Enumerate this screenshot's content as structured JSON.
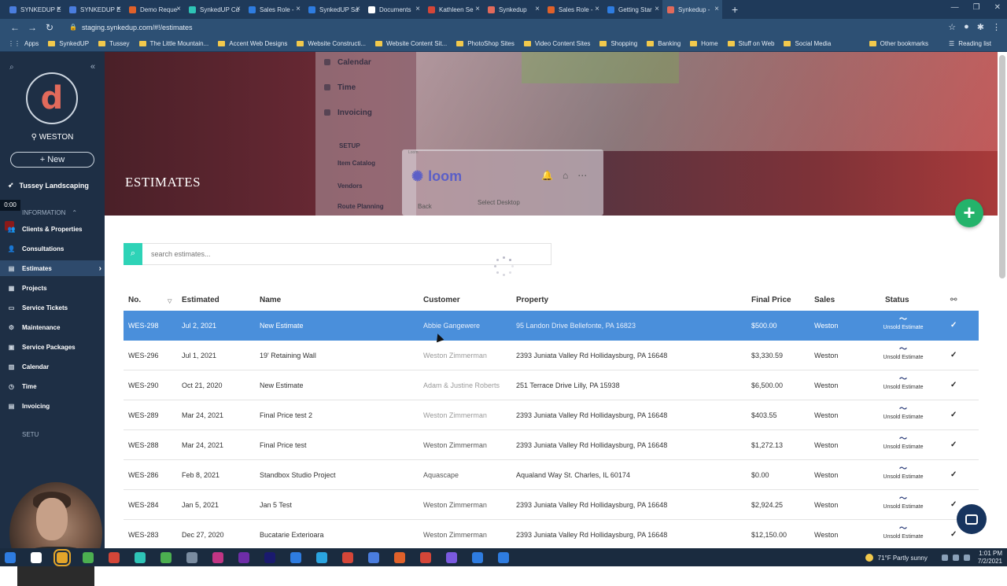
{
  "browser": {
    "tabs": [
      {
        "label": "SYNKEDUP E",
        "color": "#4a7dde"
      },
      {
        "label": "SYNKEDUP E",
        "color": "#4a7dde"
      },
      {
        "label": "Demo Reque",
        "color": "#e0612a"
      },
      {
        "label": "SynkedUP Cu",
        "color": "#2ec4b6"
      },
      {
        "label": "Sales Role -",
        "color": "#2e7ce0"
      },
      {
        "label": "SynkedUP Sa",
        "color": "#2e7ce0"
      },
      {
        "label": "Documents",
        "color": "#ffffff"
      },
      {
        "label": "Kathleen Se",
        "color": "#d44638"
      },
      {
        "label": "Synkedup",
        "color": "#e26a5b"
      },
      {
        "label": "Sales Role -",
        "color": "#e0612a"
      },
      {
        "label": "Getting Star",
        "color": "#2e7ce0"
      },
      {
        "label": "Synkedup -",
        "color": "#e26a5b"
      }
    ],
    "url": "staging.synkedup.com/#!/estimates",
    "bookmarks": [
      "SynkedUP",
      "Tussey",
      "The Little Mountain...",
      "Accent Web Designs",
      "Website Constructi...",
      "Website Content Sit...",
      "PhotoShop Sites",
      "Video Content Sites",
      "Shopping",
      "Banking",
      "Home",
      "Stuff on Web",
      "Social Media"
    ],
    "bookmarks_first": "Apps",
    "bookmarks_right": [
      "Other bookmarks",
      "Reading list"
    ]
  },
  "sidebar": {
    "logo_letter": "d",
    "user": "WESTON",
    "new_button": "New",
    "company": "Tussey Landscaping",
    "timer": "0:00",
    "section_info": "INFORMATION",
    "items": [
      {
        "label": "Clients & Properties",
        "icon": "users-icon"
      },
      {
        "label": "Consultations",
        "icon": "user-icon"
      },
      {
        "label": "Estimates",
        "icon": "estimate-icon"
      },
      {
        "label": "Projects",
        "icon": "projects-icon"
      },
      {
        "label": "Service Tickets",
        "icon": "ticket-icon"
      },
      {
        "label": "Maintenance",
        "icon": "maintenance-icon"
      },
      {
        "label": "Service Packages",
        "icon": "package-icon"
      },
      {
        "label": "Calendar",
        "icon": "calendar-icon"
      },
      {
        "label": "Time",
        "icon": "clock-icon"
      },
      {
        "label": "Invoicing",
        "icon": "invoice-icon"
      }
    ],
    "setup_label": "SETU"
  },
  "banner": {
    "title": "ESTIMATES",
    "ghost_menu": [
      "Calendar",
      "Time",
      "Invoicing",
      "SETUP",
      "Item Catalog",
      "Vendors",
      "Route Planning"
    ],
    "loom": {
      "label": "Loom",
      "brand": "loom",
      "back": "Back",
      "select": "Select Desktop"
    }
  },
  "search": {
    "placeholder": "search estimates..."
  },
  "table": {
    "headers": {
      "no": "No.",
      "estimated": "Estimated",
      "name": "Name",
      "customer": "Customer",
      "property": "Property",
      "final_price": "Final Price",
      "sales": "Sales",
      "status": "Status"
    },
    "rows": [
      {
        "no": "WES-298",
        "date": "Jul 2, 2021",
        "name": "New Estimate",
        "customer": "Abbie Gangewere",
        "property": "95 Landon Drive Bellefonte, PA 16823",
        "price": "$500.00",
        "sales": "Weston",
        "status": "Unsold Estimate"
      },
      {
        "no": "WES-296",
        "date": "Jul 1, 2021",
        "name": "19' Retaining Wall",
        "customer": "Weston Zimmerman",
        "property": "2393 Juniata Valley Rd Hollidaysburg, PA 16648",
        "price": "$3,330.59",
        "sales": "Weston",
        "status": "Unsold Estimate"
      },
      {
        "no": "WES-290",
        "date": "Oct 21, 2020",
        "name": "New Estimate",
        "customer": "Adam & Justine Roberts",
        "property": "251 Terrace Drive Lilly, PA 15938",
        "price": "$6,500.00",
        "sales": "Weston",
        "status": "Unsold Estimate"
      },
      {
        "no": "WES-289",
        "date": "Mar 24, 2021",
        "name": "Final Price test 2",
        "customer": "Weston Zimmerman",
        "property": "2393 Juniata Valley Rd Hollidaysburg, PA 16648",
        "price": "$403.55",
        "sales": "Weston",
        "status": "Unsold Estimate"
      },
      {
        "no": "WES-288",
        "date": "Mar 24, 2021",
        "name": "Final Price test",
        "customer": "Weston Zimmerman",
        "property": "2393 Juniata Valley Rd Hollidaysburg, PA 16648",
        "price": "$1,272.13",
        "sales": "Weston",
        "status": "Unsold Estimate"
      },
      {
        "no": "WES-286",
        "date": "Feb 8, 2021",
        "name": "Standbox Studio Project",
        "customer": "Aquascape",
        "property": "Aqualand Way St. Charles, IL 60174",
        "price": "$0.00",
        "sales": "Weston",
        "status": "Unsold Estimate"
      },
      {
        "no": "WES-284",
        "date": "Jan 5, 2021",
        "name": "Jan 5 Test",
        "customer": "Weston Zimmerman",
        "property": "2393 Juniata Valley Rd Hollidaysburg, PA 16648",
        "price": "$2,924.25",
        "sales": "Weston",
        "status": "Unsold Estimate"
      },
      {
        "no": "WES-283",
        "date": "Dec 27, 2020",
        "name": "Bucatarie Exterioara",
        "customer": "Weston Zimmerman",
        "property": "2393 Juniata Valley Rd Hollidaysburg, PA 16648",
        "price": "$12,150.00",
        "sales": "Weston",
        "status": "Unsold Estimate"
      }
    ]
  },
  "taskbar": {
    "weather": "71°F  Partly sunny",
    "time": "1:01 PM",
    "date": "7/2/2021",
    "icon_colors": [
      "#2e7ce0",
      "#ffffff",
      "#e3a52a",
      "#4caf50",
      "#d44638",
      "#2ec4b6",
      "#4caf50",
      "#7a8ca0",
      "#c13584",
      "#6f2da8",
      "#1a1a6e",
      "#2e7ce0",
      "#2aa4e0",
      "#d44638",
      "#4a7dde",
      "#e0612a",
      "#d44638",
      "#7a5ae0",
      "#2e7ce0",
      "#2e7ce0"
    ]
  },
  "colors": {
    "selected_row": "#4a8fdb",
    "sidebar": "#1e2f45",
    "fab": "#24b36b",
    "search_accent": "#2ed3b7"
  }
}
